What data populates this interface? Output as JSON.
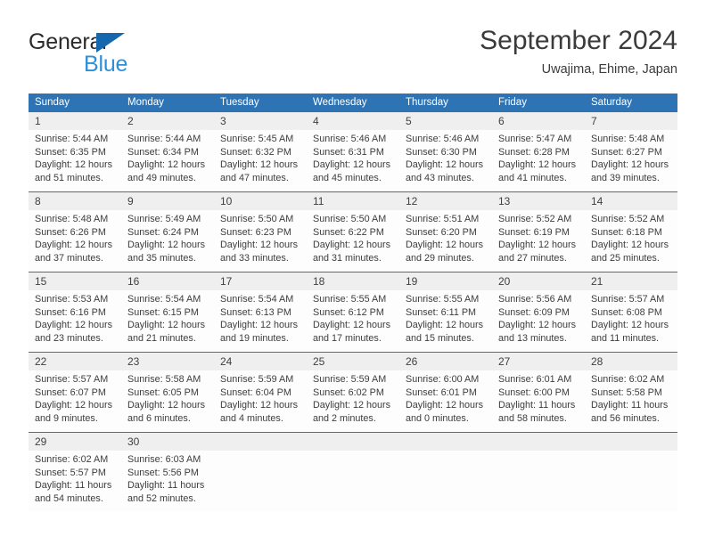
{
  "brand": {
    "name_part1": "General",
    "name_part2": "Blue",
    "logo_icon": "triangle-logo-icon"
  },
  "header": {
    "title": "September 2024",
    "subtitle": "Uwajima, Ehime, Japan"
  },
  "colors": {
    "header_blue": "#2e74b5",
    "brand_blue": "#2e8fd8",
    "logo_blue": "#1567ae",
    "daynum_band": "#efefef",
    "text": "#3d3d3d"
  },
  "weekdays": [
    "Sunday",
    "Monday",
    "Tuesday",
    "Wednesday",
    "Thursday",
    "Friday",
    "Saturday"
  ],
  "weeks": [
    {
      "days": [
        {
          "num": "1",
          "sunrise": "Sunrise: 5:44 AM",
          "sunset": "Sunset: 6:35 PM",
          "daylight1": "Daylight: 12 hours",
          "daylight2": "and 51 minutes."
        },
        {
          "num": "2",
          "sunrise": "Sunrise: 5:44 AM",
          "sunset": "Sunset: 6:34 PM",
          "daylight1": "Daylight: 12 hours",
          "daylight2": "and 49 minutes."
        },
        {
          "num": "3",
          "sunrise": "Sunrise: 5:45 AM",
          "sunset": "Sunset: 6:32 PM",
          "daylight1": "Daylight: 12 hours",
          "daylight2": "and 47 minutes."
        },
        {
          "num": "4",
          "sunrise": "Sunrise: 5:46 AM",
          "sunset": "Sunset: 6:31 PM",
          "daylight1": "Daylight: 12 hours",
          "daylight2": "and 45 minutes."
        },
        {
          "num": "5",
          "sunrise": "Sunrise: 5:46 AM",
          "sunset": "Sunset: 6:30 PM",
          "daylight1": "Daylight: 12 hours",
          "daylight2": "and 43 minutes."
        },
        {
          "num": "6",
          "sunrise": "Sunrise: 5:47 AM",
          "sunset": "Sunset: 6:28 PM",
          "daylight1": "Daylight: 12 hours",
          "daylight2": "and 41 minutes."
        },
        {
          "num": "7",
          "sunrise": "Sunrise: 5:48 AM",
          "sunset": "Sunset: 6:27 PM",
          "daylight1": "Daylight: 12 hours",
          "daylight2": "and 39 minutes."
        }
      ]
    },
    {
      "days": [
        {
          "num": "8",
          "sunrise": "Sunrise: 5:48 AM",
          "sunset": "Sunset: 6:26 PM",
          "daylight1": "Daylight: 12 hours",
          "daylight2": "and 37 minutes."
        },
        {
          "num": "9",
          "sunrise": "Sunrise: 5:49 AM",
          "sunset": "Sunset: 6:24 PM",
          "daylight1": "Daylight: 12 hours",
          "daylight2": "and 35 minutes."
        },
        {
          "num": "10",
          "sunrise": "Sunrise: 5:50 AM",
          "sunset": "Sunset: 6:23 PM",
          "daylight1": "Daylight: 12 hours",
          "daylight2": "and 33 minutes."
        },
        {
          "num": "11",
          "sunrise": "Sunrise: 5:50 AM",
          "sunset": "Sunset: 6:22 PM",
          "daylight1": "Daylight: 12 hours",
          "daylight2": "and 31 minutes."
        },
        {
          "num": "12",
          "sunrise": "Sunrise: 5:51 AM",
          "sunset": "Sunset: 6:20 PM",
          "daylight1": "Daylight: 12 hours",
          "daylight2": "and 29 minutes."
        },
        {
          "num": "13",
          "sunrise": "Sunrise: 5:52 AM",
          "sunset": "Sunset: 6:19 PM",
          "daylight1": "Daylight: 12 hours",
          "daylight2": "and 27 minutes."
        },
        {
          "num": "14",
          "sunrise": "Sunrise: 5:52 AM",
          "sunset": "Sunset: 6:18 PM",
          "daylight1": "Daylight: 12 hours",
          "daylight2": "and 25 minutes."
        }
      ]
    },
    {
      "days": [
        {
          "num": "15",
          "sunrise": "Sunrise: 5:53 AM",
          "sunset": "Sunset: 6:16 PM",
          "daylight1": "Daylight: 12 hours",
          "daylight2": "and 23 minutes."
        },
        {
          "num": "16",
          "sunrise": "Sunrise: 5:54 AM",
          "sunset": "Sunset: 6:15 PM",
          "daylight1": "Daylight: 12 hours",
          "daylight2": "and 21 minutes."
        },
        {
          "num": "17",
          "sunrise": "Sunrise: 5:54 AM",
          "sunset": "Sunset: 6:13 PM",
          "daylight1": "Daylight: 12 hours",
          "daylight2": "and 19 minutes."
        },
        {
          "num": "18",
          "sunrise": "Sunrise: 5:55 AM",
          "sunset": "Sunset: 6:12 PM",
          "daylight1": "Daylight: 12 hours",
          "daylight2": "and 17 minutes."
        },
        {
          "num": "19",
          "sunrise": "Sunrise: 5:55 AM",
          "sunset": "Sunset: 6:11 PM",
          "daylight1": "Daylight: 12 hours",
          "daylight2": "and 15 minutes."
        },
        {
          "num": "20",
          "sunrise": "Sunrise: 5:56 AM",
          "sunset": "Sunset: 6:09 PM",
          "daylight1": "Daylight: 12 hours",
          "daylight2": "and 13 minutes."
        },
        {
          "num": "21",
          "sunrise": "Sunrise: 5:57 AM",
          "sunset": "Sunset: 6:08 PM",
          "daylight1": "Daylight: 12 hours",
          "daylight2": "and 11 minutes."
        }
      ]
    },
    {
      "days": [
        {
          "num": "22",
          "sunrise": "Sunrise: 5:57 AM",
          "sunset": "Sunset: 6:07 PM",
          "daylight1": "Daylight: 12 hours",
          "daylight2": "and 9 minutes."
        },
        {
          "num": "23",
          "sunrise": "Sunrise: 5:58 AM",
          "sunset": "Sunset: 6:05 PM",
          "daylight1": "Daylight: 12 hours",
          "daylight2": "and 6 minutes."
        },
        {
          "num": "24",
          "sunrise": "Sunrise: 5:59 AM",
          "sunset": "Sunset: 6:04 PM",
          "daylight1": "Daylight: 12 hours",
          "daylight2": "and 4 minutes."
        },
        {
          "num": "25",
          "sunrise": "Sunrise: 5:59 AM",
          "sunset": "Sunset: 6:02 PM",
          "daylight1": "Daylight: 12 hours",
          "daylight2": "and 2 minutes."
        },
        {
          "num": "26",
          "sunrise": "Sunrise: 6:00 AM",
          "sunset": "Sunset: 6:01 PM",
          "daylight1": "Daylight: 12 hours",
          "daylight2": "and 0 minutes."
        },
        {
          "num": "27",
          "sunrise": "Sunrise: 6:01 AM",
          "sunset": "Sunset: 6:00 PM",
          "daylight1": "Daylight: 11 hours",
          "daylight2": "and 58 minutes."
        },
        {
          "num": "28",
          "sunrise": "Sunrise: 6:02 AM",
          "sunset": "Sunset: 5:58 PM",
          "daylight1": "Daylight: 11 hours",
          "daylight2": "and 56 minutes."
        }
      ]
    },
    {
      "days": [
        {
          "num": "29",
          "sunrise": "Sunrise: 6:02 AM",
          "sunset": "Sunset: 5:57 PM",
          "daylight1": "Daylight: 11 hours",
          "daylight2": "and 54 minutes."
        },
        {
          "num": "30",
          "sunrise": "Sunrise: 6:03 AM",
          "sunset": "Sunset: 5:56 PM",
          "daylight1": "Daylight: 11 hours",
          "daylight2": "and 52 minutes."
        },
        {
          "num": "",
          "sunrise": "",
          "sunset": "",
          "daylight1": "",
          "daylight2": ""
        },
        {
          "num": "",
          "sunrise": "",
          "sunset": "",
          "daylight1": "",
          "daylight2": ""
        },
        {
          "num": "",
          "sunrise": "",
          "sunset": "",
          "daylight1": "",
          "daylight2": ""
        },
        {
          "num": "",
          "sunrise": "",
          "sunset": "",
          "daylight1": "",
          "daylight2": ""
        },
        {
          "num": "",
          "sunrise": "",
          "sunset": "",
          "daylight1": "",
          "daylight2": ""
        }
      ]
    }
  ]
}
